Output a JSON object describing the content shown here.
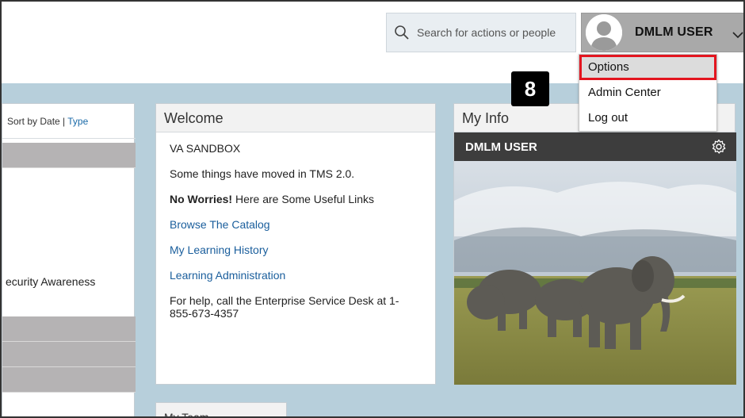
{
  "header": {
    "search": {
      "placeholder": "Search for actions or people",
      "icon": "search-icon"
    },
    "user": {
      "name": "DMLM USER",
      "icon": "chevron-down-icon"
    }
  },
  "user_menu": {
    "items": [
      {
        "label": "Options",
        "active": true
      },
      {
        "label": "Admin Center"
      },
      {
        "label": "Log out"
      }
    ]
  },
  "step_badge": "8",
  "left_panel": {
    "sort_prefix": "Sort by Date | ",
    "sort_type": "Type",
    "visible_text": "ecurity Awareness"
  },
  "welcome": {
    "title": "Welcome",
    "org": "VA SANDBOX",
    "moved": "Some things have moved in TMS 2.0.",
    "no_worries_bold": "No Worries!",
    "no_worries_rest": " Here are Some Useful Links",
    "links": [
      "Browse The Catalog",
      "My Learning History",
      "Learning Administration"
    ],
    "help": "For help, call the Enterprise Service Desk at 1-855-673-4357"
  },
  "my_info": {
    "title": "My Info",
    "user_name": "DMLM USER",
    "icon": "gear-icon"
  },
  "my_team": {
    "title": "My Team"
  },
  "colors": {
    "main_bg": "#b7cfdb",
    "link": "#1a5e9c",
    "highlight": "#e3151f",
    "banner": "#3d3d3d"
  }
}
